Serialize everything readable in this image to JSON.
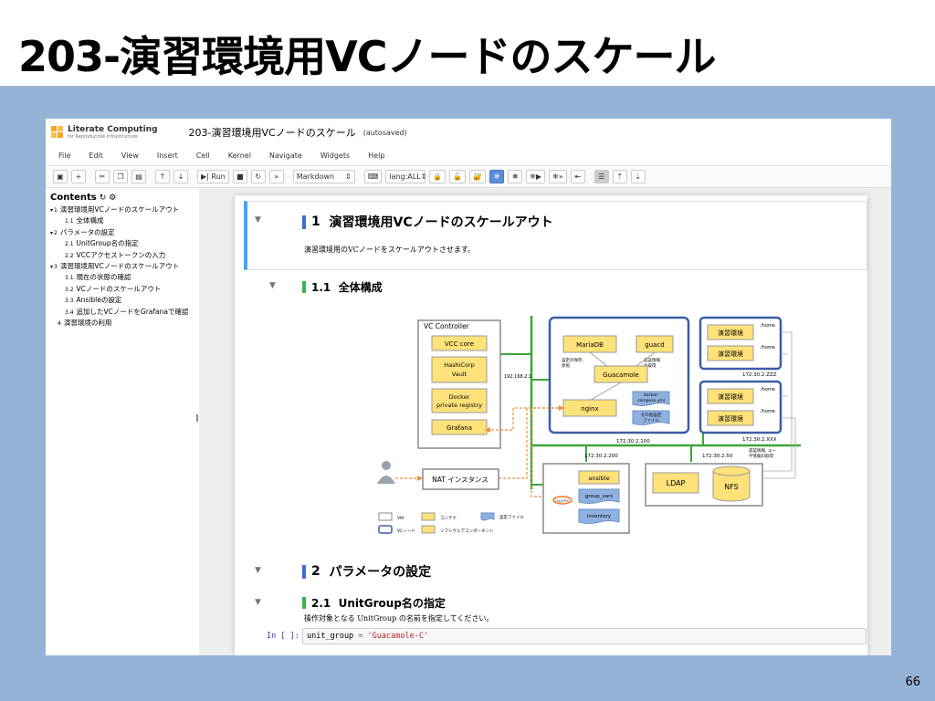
{
  "slide": {
    "title": "203-演習環境用VCノードのスケール",
    "page_number": "66"
  },
  "notebook": {
    "logo_name": "Literate Computing",
    "logo_sub": "for Reproducible Infrastructure",
    "title": "203-演習環境用VCノードのスケール",
    "status": "(autosaved)",
    "menu": [
      "File",
      "Edit",
      "View",
      "Insert",
      "Cell",
      "Kernel",
      "Navigate",
      "Widgets",
      "Help"
    ],
    "toolbar": {
      "run_label": "Run",
      "cell_type": "Markdown",
      "lang": "lang:ALL"
    }
  },
  "toc": {
    "title": "Contents",
    "items": [
      {
        "num": "1",
        "label": "演習環境用VCノードのスケールアウト",
        "level": 1,
        "arrow": "▾"
      },
      {
        "num": "1.1",
        "label": "全体構成",
        "level": 2
      },
      {
        "num": "2",
        "label": "パラメータの設定",
        "level": 1,
        "arrow": "▾"
      },
      {
        "num": "2.1",
        "label": "UnitGroup名の指定",
        "level": 2
      },
      {
        "num": "2.2",
        "label": "VCCアクセストークンの入力",
        "level": 2
      },
      {
        "num": "3",
        "label": "演習環境用VCノードのスケールアウト",
        "level": 1,
        "arrow": "▾"
      },
      {
        "num": "3.1",
        "label": "現在の状態の確認",
        "level": 2
      },
      {
        "num": "3.2",
        "label": "VCノードのスケールアウト",
        "level": 2
      },
      {
        "num": "3.3",
        "label": "Ansibleの設定",
        "level": 2
      },
      {
        "num": "3.4",
        "label": "追加したVCノードをGrafanaで確認",
        "level": 2
      },
      {
        "num": "4",
        "label": "演習環境の利用",
        "level": 1
      }
    ]
  },
  "cells": {
    "h1_1": {
      "num": "1",
      "text": "演習環境用VCノードのスケールアウト"
    },
    "p1": "演習環境用のVCノードをスケールアウトさせます。",
    "h2_1_1": {
      "num": "1.1",
      "text": "全体構成"
    },
    "h1_2": {
      "num": "2",
      "text": "パラメータの設定"
    },
    "h2_2_1": {
      "num": "2.1",
      "text": "UnitGroup名の指定"
    },
    "p2": "操作対象となる UnitGroup の名前を指定してください。",
    "code": {
      "prompt": "In [ ]:",
      "var": "unit_group",
      "op": " = ",
      "value": "'Guacamole-C'"
    }
  },
  "diagram": {
    "vc_controller": "VC Controller",
    "vcc_core": "VCC core",
    "vault_l1": "HashiCorp",
    "vault_l2": "Vault",
    "docker_l1": "Docker",
    "docker_l2": "private registry",
    "grafana": "Grafana",
    "ip_ctrl": "192.168.2.1",
    "mariadb": "MariaDB",
    "guacd": "guacd",
    "save_note_l1": "設定の保存,",
    "save_note_l2": "参照",
    "auth_note_l1": "認証情報",
    "auth_note_l2": "の取得",
    "guacamole": "Guacamole",
    "nginx": "nginx",
    "compose_l1": "docker-",
    "compose_l2": "compose.yml",
    "other_l1": "その他設定",
    "other_l2": "ファイル",
    "ip_100": "172.30.2.100",
    "env": "演習環境",
    "home": "/home",
    "ip_zzz": "172.30.2.ZZZ",
    "ip_xxx": "172.30.2.XXX",
    "ip_200": "172.30.2.200",
    "ip_50": "172.30.2.50",
    "auth_note2_l1": "認証情報, ユー",
    "auth_note2_l2": "ザ情報の取得",
    "nat": "NAT インスタンス",
    "ansible": "ansible",
    "group_vars": "group_vars",
    "inventory": "inventory",
    "jupyter": "jupyter",
    "ldap": "LDAP",
    "nfs": "NFS",
    "legend": {
      "vm": "VM",
      "container": "コンテナ",
      "config": "設定ファイル",
      "vcnode": "VCノード",
      "software": "ソフトウェアコンポーネント"
    }
  },
  "colors": {
    "panel": "#95b3d7",
    "heading_blue": "#3c6fd1",
    "heading_green": "#3db24b",
    "vcnode_border": "#3a5fa8",
    "component_fill": "#ffe27a",
    "network_green": "#3aa63a",
    "arrow_orange": "#e8913a"
  }
}
